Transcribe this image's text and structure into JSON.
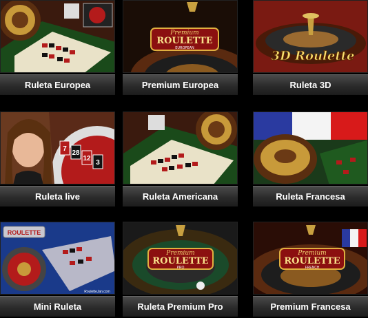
{
  "games": [
    {
      "label": "Ruleta Europea"
    },
    {
      "label": "Premium Europea",
      "logo_top": "Premium",
      "logo_main": "ROULETTE",
      "logo_sub": "EUROPEAN"
    },
    {
      "label": "Ruleta 3D",
      "logo_main": "3D Roulette"
    },
    {
      "label": "Ruleta live",
      "numbers": [
        "7",
        "28",
        "12",
        "3"
      ]
    },
    {
      "label": "Ruleta Americana"
    },
    {
      "label": "Ruleta Francesa"
    },
    {
      "label": "Mini Ruleta",
      "logo_main": "ROULETTE",
      "footer": "RouletteJan.com"
    },
    {
      "label": "Ruleta Premium Pro",
      "logo_top": "Premium",
      "logo_main": "ROULETTE",
      "logo_sub": "PRO"
    },
    {
      "label": "Premium Francesa",
      "logo_top": "Premium",
      "logo_main": "ROULETTE",
      "logo_sub": "FRENCH"
    }
  ]
}
